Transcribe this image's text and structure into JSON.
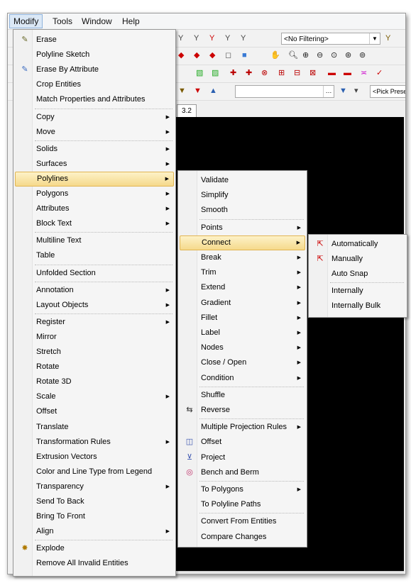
{
  "menubar": {
    "items": [
      {
        "label": "Modify",
        "active": true
      },
      {
        "label": "Tools",
        "active": false
      },
      {
        "label": "Window",
        "active": false
      },
      {
        "label": "Help",
        "active": false
      }
    ]
  },
  "toolbar": {
    "filter_value": "<No Filtering>",
    "pick_value": "<Pick Prese"
  },
  "document_tab": {
    "label": "3.2"
  },
  "modify_menu": {
    "items": [
      {
        "label": "Erase",
        "icon": "pencil-eraser-icon"
      },
      {
        "label": "Polyline Sketch"
      },
      {
        "label": "Erase By Attribute",
        "icon": "eraser-attribute-icon"
      },
      {
        "label": "Crop Entities"
      },
      {
        "label": "Match Properties and Attributes"
      },
      {
        "label": "Copy",
        "submenu": true
      },
      {
        "label": "Move",
        "submenu": true
      },
      {
        "label": "Solids",
        "submenu": true
      },
      {
        "label": "Surfaces",
        "submenu": true
      },
      {
        "label": "Polylines",
        "submenu": true,
        "highlighted": true
      },
      {
        "label": "Polygons",
        "submenu": true
      },
      {
        "label": "Attributes",
        "submenu": true
      },
      {
        "label": "Block Text",
        "submenu": true
      },
      {
        "label": "Multiline Text"
      },
      {
        "label": "Table"
      },
      {
        "label": "Unfolded Section"
      },
      {
        "label": "Annotation",
        "submenu": true
      },
      {
        "label": "Layout Objects",
        "submenu": true
      },
      {
        "label": "Register",
        "submenu": true
      },
      {
        "label": "Mirror"
      },
      {
        "label": "Stretch"
      },
      {
        "label": "Rotate"
      },
      {
        "label": "Rotate 3D"
      },
      {
        "label": "Scale",
        "submenu": true
      },
      {
        "label": "Offset"
      },
      {
        "label": "Translate"
      },
      {
        "label": "Transformation Rules",
        "submenu": true
      },
      {
        "label": "Extrusion Vectors"
      },
      {
        "label": "Color and Line Type from Legend"
      },
      {
        "label": "Transparency",
        "submenu": true
      },
      {
        "label": "Send To Back"
      },
      {
        "label": "Bring To Front"
      },
      {
        "label": "Align",
        "submenu": true
      },
      {
        "label": "Explode",
        "icon": "explode-icon"
      },
      {
        "label": "Remove All Invalid Entities"
      }
    ]
  },
  "polylines_menu": {
    "items": [
      {
        "label": "Validate"
      },
      {
        "label": "Simplify"
      },
      {
        "label": "Smooth"
      },
      {
        "label": "Points",
        "submenu": true
      },
      {
        "label": "Connect",
        "submenu": true,
        "highlighted": true
      },
      {
        "label": "Break",
        "submenu": true
      },
      {
        "label": "Trim",
        "submenu": true
      },
      {
        "label": "Extend",
        "submenu": true
      },
      {
        "label": "Gradient",
        "submenu": true
      },
      {
        "label": "Fillet",
        "submenu": true
      },
      {
        "label": "Label",
        "submenu": true
      },
      {
        "label": "Nodes",
        "submenu": true
      },
      {
        "label": "Close / Open",
        "submenu": true
      },
      {
        "label": "Condition",
        "submenu": true
      },
      {
        "label": "Shuffle"
      },
      {
        "label": "Reverse",
        "icon": "reverse-arrows-icon"
      },
      {
        "label": "Multiple Projection Rules",
        "submenu": true
      },
      {
        "label": "Offset",
        "icon": "offset-icon"
      },
      {
        "label": "Project",
        "icon": "project-icon"
      },
      {
        "label": "Bench and Berm",
        "icon": "bench-berm-icon"
      },
      {
        "label": "To Polygons",
        "submenu": true
      },
      {
        "label": "To Polyline Paths"
      },
      {
        "label": "Convert From Entities"
      },
      {
        "label": "Compare Changes"
      }
    ]
  },
  "connect_menu": {
    "items": [
      {
        "label": "Automatically",
        "icon": "connect-auto-icon"
      },
      {
        "label": "Manually",
        "icon": "connect-manual-icon"
      },
      {
        "label": "Auto Snap"
      },
      {
        "label": "Internally"
      },
      {
        "label": "Internally Bulk"
      }
    ]
  }
}
